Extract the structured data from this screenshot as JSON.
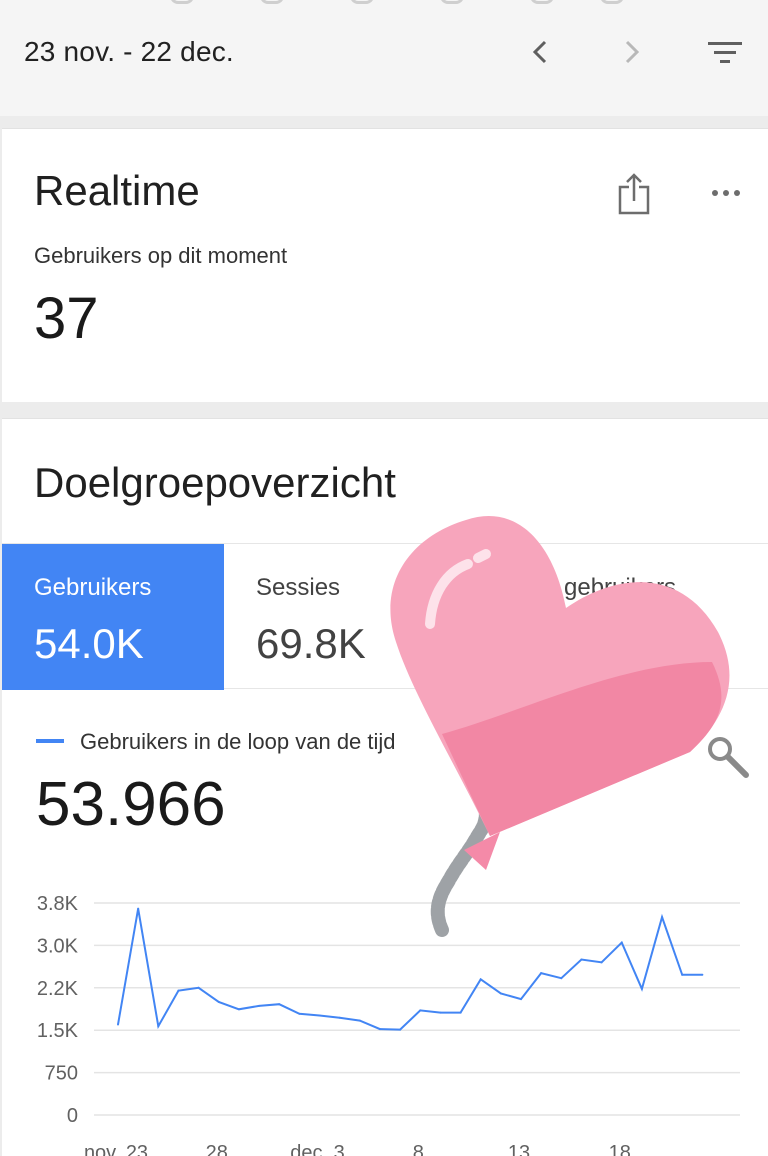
{
  "header": {
    "date_range": "23 nov. - 22 dec.",
    "prev_icon": "chevron-left-icon",
    "next_icon": "chevron-right-icon",
    "filter_icon": "filter-icon"
  },
  "realtime": {
    "title": "Realtime",
    "label": "Gebruikers op dit moment",
    "value": "37"
  },
  "audience": {
    "title": "Doelgroepoverzicht",
    "tabs": [
      {
        "label": "Gebruikers",
        "value": "54.0K"
      },
      {
        "label": "Sessies",
        "value": "69.8K"
      },
      {
        "label": "gebruikers",
        "value": ""
      }
    ],
    "series_label": "Gebruikers in de loop van de tijd",
    "series_total": "53.966",
    "accent_color": "#4285f4"
  },
  "chart_data": {
    "type": "line",
    "series": [
      {
        "name": "Gebruikers in de loop van de tijd",
        "values": [
          1600,
          3650,
          1570,
          2200,
          2250,
          2000,
          1870,
          1930,
          1960,
          1790,
          1760,
          1720,
          1670,
          1520,
          1510,
          1850,
          1810,
          1810,
          2400,
          2150,
          2050,
          2510,
          2420,
          2750,
          2700,
          3050,
          2230,
          3500,
          2480,
          2480
        ]
      }
    ],
    "x_tick_labels": [
      "nov. 23",
      "28",
      "dec. 3",
      "8",
      "13",
      "18"
    ],
    "y_tick_labels": [
      "0",
      "750",
      "1.5K",
      "2.2K",
      "3.0K",
      "3.8K"
    ],
    "ylim": [
      0,
      3750
    ],
    "grid": true,
    "line_color": "#4285f4"
  }
}
